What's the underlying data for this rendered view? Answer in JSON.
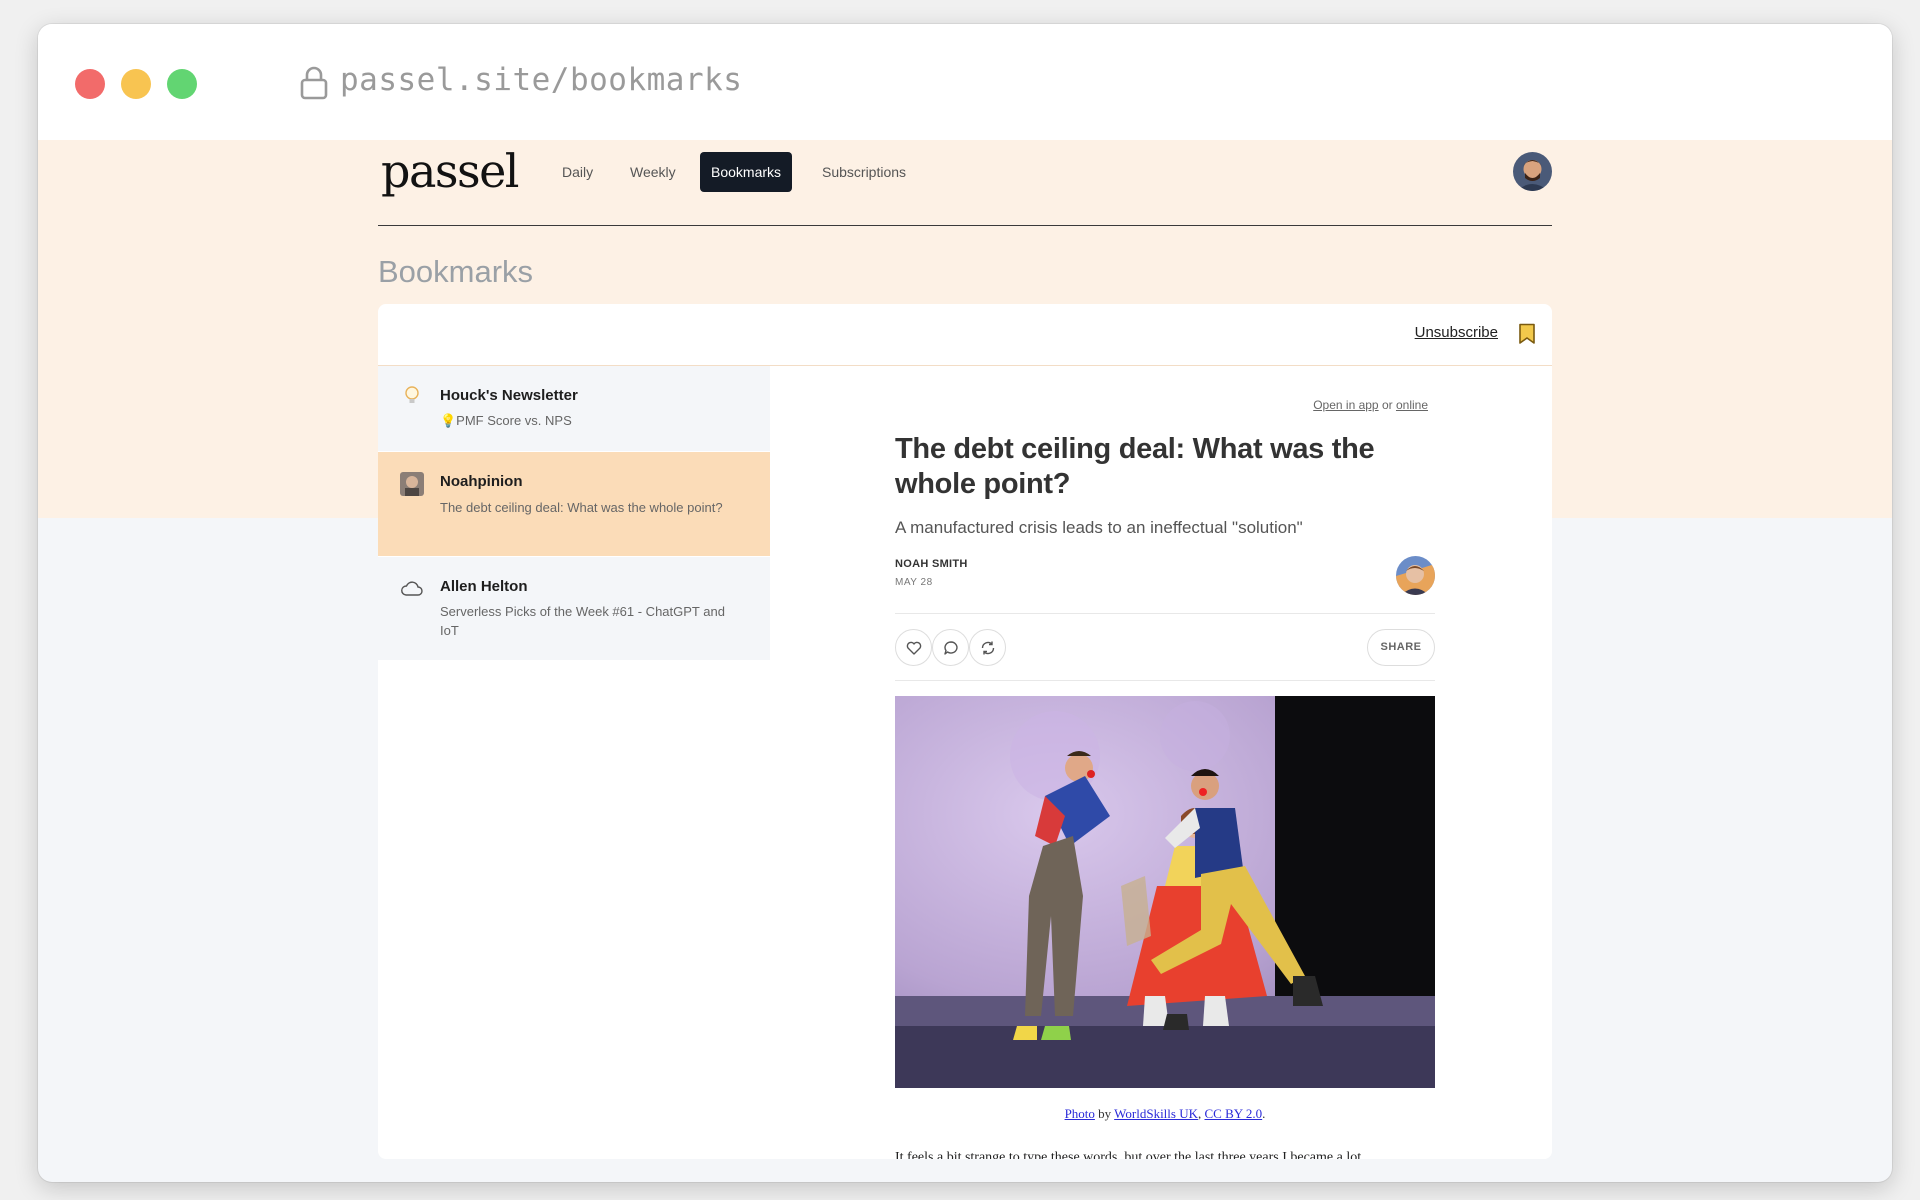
{
  "browser": {
    "url": "passel.site/bookmarks"
  },
  "app": {
    "logo": "passel",
    "nav": [
      {
        "label": "Daily",
        "active": false
      },
      {
        "label": "Weekly",
        "active": false
      },
      {
        "label": "Bookmarks",
        "active": true
      },
      {
        "label": "Subscriptions",
        "active": false
      }
    ],
    "page_title": "Bookmarks"
  },
  "card": {
    "unsubscribe_label": "Unsubscribe"
  },
  "newsletters": [
    {
      "name": "Houck's Newsletter",
      "subtitle": "💡PMF Score vs. NPS",
      "icon": "lightbulb-icon",
      "selected": false
    },
    {
      "name": "Noahpinion",
      "subtitle": "The debt ceiling deal: What was the whole point?",
      "icon": "noahpinion-logo",
      "selected": true
    },
    {
      "name": "Allen Helton",
      "subtitle": "Serverless Picks of the Week #61 - ChatGPT and IoT",
      "icon": "cloud-icon",
      "selected": false
    }
  ],
  "article": {
    "open_in_app": "Open in app",
    "or": "or",
    "online": "online",
    "title": "The debt ceiling deal: What was the whole point?",
    "subtitle": "A manufactured crisis leads to an ineffectual \"solution\"",
    "author": "NOAH SMITH",
    "date": "MAY 28",
    "share_label": "SHARE",
    "caption": {
      "photo": "Photo",
      "by": "by",
      "source": "WorldSkills UK",
      "license": "CC BY 2.0",
      "end": "."
    },
    "body_start": "It feels a bit strange to type these words, but over the last three years I became a lot"
  }
}
